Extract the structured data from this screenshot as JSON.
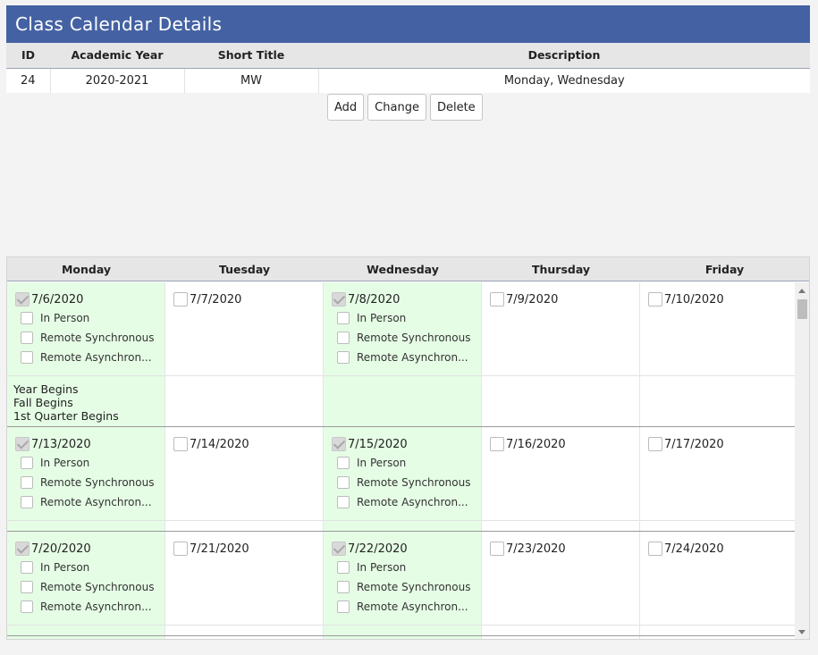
{
  "panel": {
    "title": "Class Calendar Details"
  },
  "details": {
    "columns": [
      "ID",
      "Academic Year",
      "Short Title",
      "Description"
    ],
    "row": {
      "id": "24",
      "academic_year": "2020-2021",
      "short_title": "MW",
      "description": "Monday, Wednesday"
    }
  },
  "buttons": {
    "add": "Add",
    "change": "Change",
    "delete": "Delete"
  },
  "calendar": {
    "day_headers": [
      "Monday",
      "Tuesday",
      "Wednesday",
      "Thursday",
      "Friday"
    ],
    "options": [
      "In Person",
      "Remote Synchronous",
      "Remote Asynchron..."
    ],
    "weeks": [
      {
        "days": [
          {
            "date": "7/6/2020",
            "checked": true,
            "notes": [
              "Year Begins",
              "Fall Begins",
              "1st Quarter Begins"
            ]
          },
          {
            "date": "7/7/2020",
            "checked": false,
            "notes": []
          },
          {
            "date": "7/8/2020",
            "checked": true,
            "notes": []
          },
          {
            "date": "7/9/2020",
            "checked": false,
            "notes": []
          },
          {
            "date": "7/10/2020",
            "checked": false,
            "notes": []
          }
        ]
      },
      {
        "days": [
          {
            "date": "7/13/2020",
            "checked": true,
            "notes": []
          },
          {
            "date": "7/14/2020",
            "checked": false,
            "notes": []
          },
          {
            "date": "7/15/2020",
            "checked": true,
            "notes": []
          },
          {
            "date": "7/16/2020",
            "checked": false,
            "notes": []
          },
          {
            "date": "7/17/2020",
            "checked": false,
            "notes": []
          }
        ]
      },
      {
        "days": [
          {
            "date": "7/20/2020",
            "checked": true,
            "notes": []
          },
          {
            "date": "7/21/2020",
            "checked": false,
            "notes": []
          },
          {
            "date": "7/22/2020",
            "checked": true,
            "notes": []
          },
          {
            "date": "7/23/2020",
            "checked": false,
            "notes": []
          },
          {
            "date": "7/24/2020",
            "checked": false,
            "notes": []
          }
        ]
      }
    ]
  },
  "colors": {
    "title_bar": "#4462a3",
    "active_day": "#e5fde5"
  }
}
